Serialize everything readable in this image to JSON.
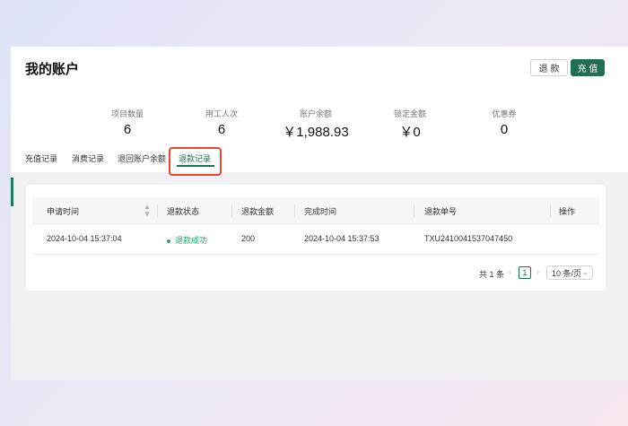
{
  "header": {
    "title": "我的账户",
    "refund_label": "退 款",
    "recharge_label": "充 值"
  },
  "stats": [
    {
      "label": "项目数量",
      "value": "6"
    },
    {
      "label": "用工人次",
      "value": "6"
    },
    {
      "label": "账户余额",
      "value": "￥1,988.93"
    },
    {
      "label": "锁定金额",
      "value": "￥0"
    },
    {
      "label": "优惠券",
      "value": "0"
    }
  ],
  "tabs": [
    {
      "label": "充值记录"
    },
    {
      "label": "消费记录"
    },
    {
      "label": "退回账户余额"
    },
    {
      "label": "退款记录",
      "active": true
    }
  ],
  "table": {
    "columns": [
      "申请时间",
      "退款状态",
      "退款金额",
      "完成时间",
      "退款单号",
      "操作"
    ],
    "rows": [
      {
        "apply_time": "2024-10-04 15:37:04",
        "status": "退款成功",
        "amount": "200",
        "finish_time": "2024-10-04 15:37:53",
        "refund_no": "TXU2410041537047450",
        "action": ""
      }
    ]
  },
  "pagination": {
    "total_text": "共 1 条",
    "current_page": "1",
    "page_size": "10 条/页"
  },
  "colors": {
    "accent": "#1f6e55",
    "success": "#2aa36b",
    "highlight": "#e0473d"
  }
}
